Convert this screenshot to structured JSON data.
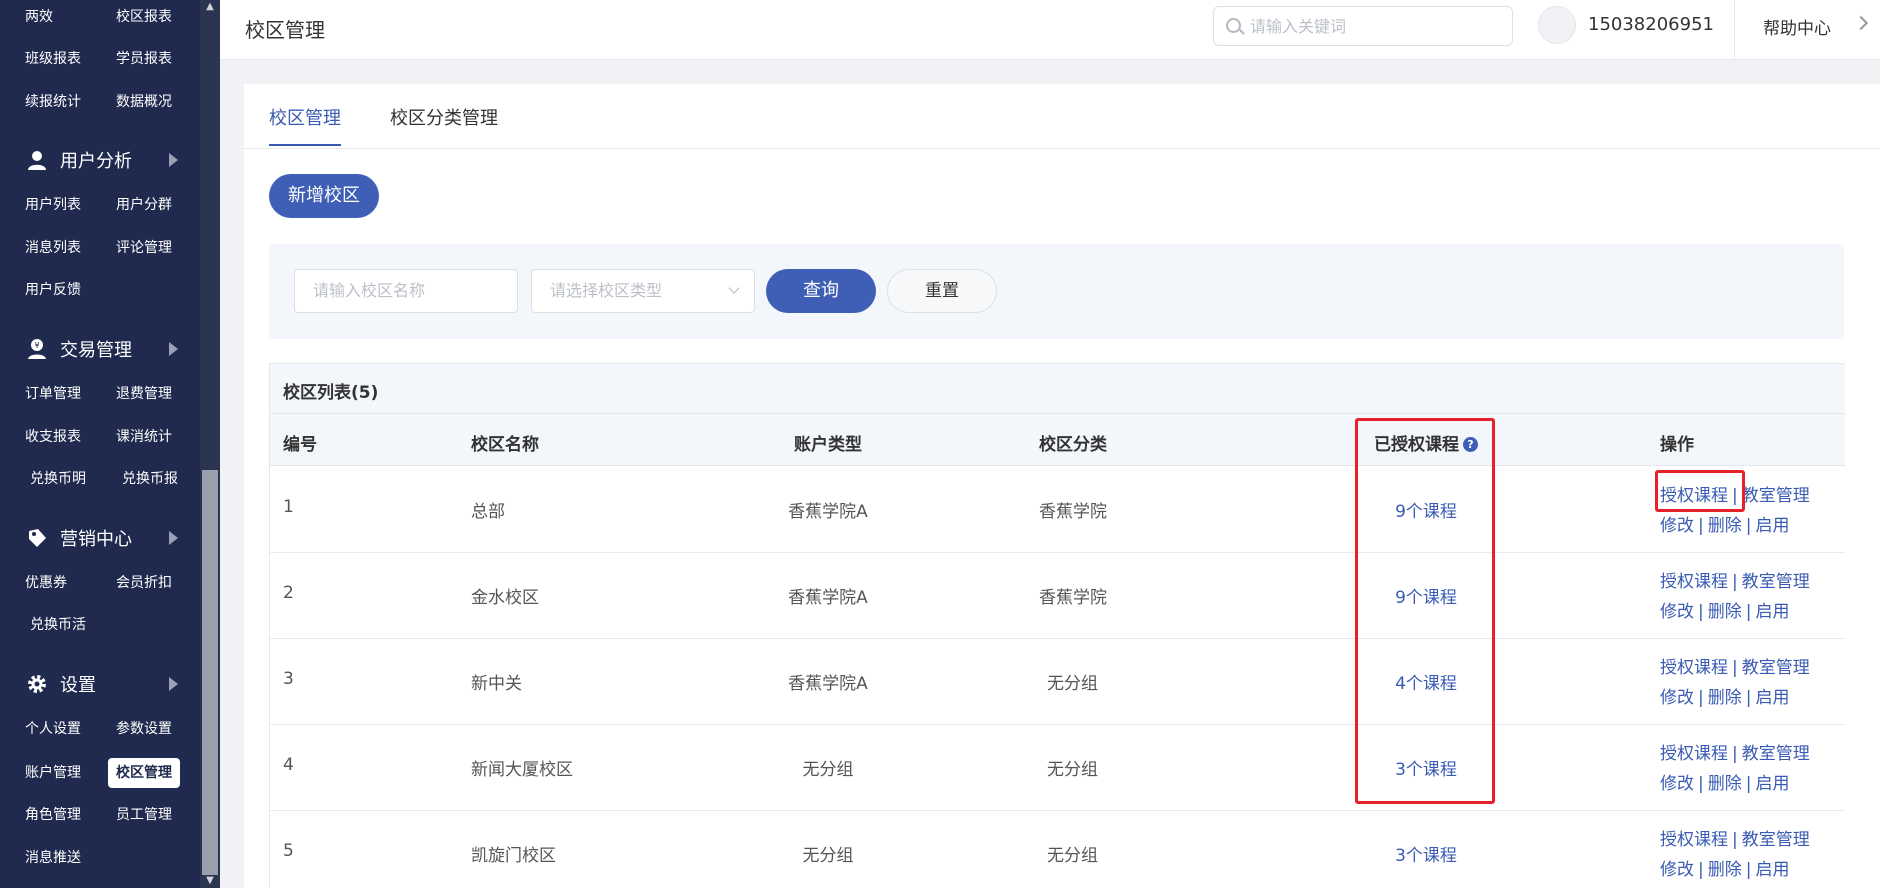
{
  "sidebar": {
    "rows": [
      {
        "a": "两效",
        "b": "校区报表"
      },
      {
        "a": "班级报表",
        "b": "学员报表"
      },
      {
        "a": "续报统计",
        "b": "数据概况"
      }
    ],
    "sections": [
      {
        "icon": "user-icon",
        "label": "用户分析",
        "rows": [
          {
            "a": "用户列表",
            "b": "用户分群"
          },
          {
            "a": "消息列表",
            "b": "评论管理"
          },
          {
            "a": "用户反馈",
            "b": ""
          }
        ]
      },
      {
        "icon": "trade-icon",
        "label": "交易管理",
        "rows": [
          {
            "a": "订单管理",
            "b": "退费管理"
          },
          {
            "a": "收支报表",
            "b": "课消统计"
          },
          {
            "a": "兑换币明",
            "b": "兑换币报"
          }
        ]
      },
      {
        "icon": "marketing-icon",
        "label": "营销中心",
        "rows": [
          {
            "a": "优惠券",
            "b": "会员折扣"
          },
          {
            "a": "兑换币活",
            "b": ""
          }
        ]
      },
      {
        "icon": "gear-icon",
        "label": "设置",
        "rows": [
          {
            "a": "个人设置",
            "b": "参数设置"
          },
          {
            "a": "账户管理",
            "b": "校区管理"
          },
          {
            "a": "角色管理",
            "b": "员工管理"
          },
          {
            "a": "消息推送",
            "b": ""
          }
        ]
      }
    ]
  },
  "header": {
    "title": "校区管理",
    "search_placeholder": "请输入关键词",
    "phone": "15038206951",
    "help": "帮助中心"
  },
  "tabs": [
    {
      "label": "校区管理",
      "active": true
    },
    {
      "label": "校区分类管理",
      "active": false
    }
  ],
  "add_button": "新增校区",
  "filter": {
    "name_placeholder": "请输入校区名称",
    "type_placeholder": "请选择校区类型",
    "query": "查询",
    "reset": "重置"
  },
  "table": {
    "title": "校区列表(5)",
    "headers": {
      "id": "编号",
      "name": "校区名称",
      "account": "账户类型",
      "category": "校区分类",
      "courses": "已授权课程",
      "ops": "操作"
    },
    "ops": {
      "authorize": "授权课程",
      "classroom": "教室管理",
      "edit": "修改",
      "delete": "删除",
      "enable": "启用"
    },
    "rows": [
      {
        "id": "1",
        "name": "总部",
        "account": "香蕉学院A",
        "category": "香蕉学院",
        "courses": "9个课程"
      },
      {
        "id": "2",
        "name": "金水校区",
        "account": "香蕉学院A",
        "category": "香蕉学院",
        "courses": "9个课程"
      },
      {
        "id": "3",
        "name": "新中关",
        "account": "香蕉学院A",
        "category": "无分组",
        "courses": "4个课程"
      },
      {
        "id": "4",
        "name": "新闻大厦校区",
        "account": "无分组",
        "category": "无分组",
        "courses": "3个课程"
      },
      {
        "id": "5",
        "name": "凯旋门校区",
        "account": "无分组",
        "category": "无分组",
        "courses": "3个课程"
      }
    ]
  },
  "colors": {
    "sidebar": "#1f2a4e",
    "primary": "#3f5eb5",
    "link": "#3a5bb3",
    "highlight": "#e8202a"
  }
}
